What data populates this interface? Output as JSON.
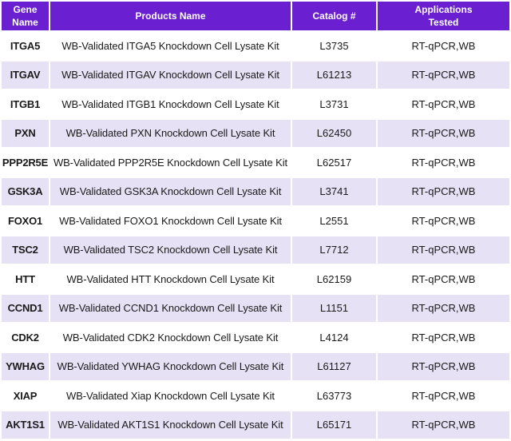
{
  "colors": {
    "header_bg": "#6a1fd0",
    "header_text": "#ffffff",
    "row_alt_bg": "#e7e1f5",
    "row_bg": "#ffffff"
  },
  "table": {
    "headers": {
      "gene": "Gene\nName",
      "product": "Products Name",
      "catalog": "Catalog #",
      "apps": "Applications\nTested"
    },
    "rows": [
      {
        "gene": "ITGA5",
        "product": "WB-Validated ITGA5 Knockdown Cell Lysate Kit",
        "catalog": "L3735",
        "apps": "RT-qPCR,WB"
      },
      {
        "gene": "ITGAV",
        "product": "WB-Validated ITGAV Knockdown Cell Lysate Kit",
        "catalog": "L61213",
        "apps": "RT-qPCR,WB"
      },
      {
        "gene": "ITGB1",
        "product": "WB-Validated ITGB1 Knockdown Cell Lysate Kit",
        "catalog": "L3731",
        "apps": "RT-qPCR,WB"
      },
      {
        "gene": "PXN",
        "product": "WB-Validated PXN Knockdown Cell Lysate Kit",
        "catalog": "L62450",
        "apps": "RT-qPCR,WB"
      },
      {
        "gene": "PPP2R5E",
        "product": "WB-Validated PPP2R5E Knockdown Cell Lysate Kit",
        "catalog": "L62517",
        "apps": "RT-qPCR,WB"
      },
      {
        "gene": "GSK3A",
        "product": "WB-Validated GSK3A Knockdown Cell Lysate Kit",
        "catalog": "L3741",
        "apps": "RT-qPCR,WB"
      },
      {
        "gene": "FOXO1",
        "product": "WB-Validated FOXO1 Knockdown Cell Lysate Kit",
        "catalog": "L2551",
        "apps": "RT-qPCR,WB"
      },
      {
        "gene": "TSC2",
        "product": "WB-Validated TSC2 Knockdown Cell Lysate Kit",
        "catalog": "L7712",
        "apps": "RT-qPCR,WB"
      },
      {
        "gene": "HTT",
        "product": "WB-Validated HTT Knockdown Cell Lysate Kit",
        "catalog": "L62159",
        "apps": "RT-qPCR,WB"
      },
      {
        "gene": "CCND1",
        "product": "WB-Validated CCND1 Knockdown Cell Lysate Kit",
        "catalog": "L1151",
        "apps": "RT-qPCR,WB"
      },
      {
        "gene": "CDK2",
        "product": "WB-Validated CDK2 Knockdown Cell Lysate Kit",
        "catalog": "L4124",
        "apps": "RT-qPCR,WB"
      },
      {
        "gene": "YWHAG",
        "product": "WB-Validated YWHAG Knockdown Cell Lysate Kit",
        "catalog": "L61127",
        "apps": "RT-qPCR,WB"
      },
      {
        "gene": "XIAP",
        "product": "WB-Validated Xiap Knockdown Cell Lysate Kit",
        "catalog": "L63773",
        "apps": "RT-qPCR,WB"
      },
      {
        "gene": "AKT1S1",
        "product": "WB-Validated AKT1S1 Knockdown Cell Lysate Kit",
        "catalog": "L65171",
        "apps": "RT-qPCR,WB"
      }
    ]
  }
}
